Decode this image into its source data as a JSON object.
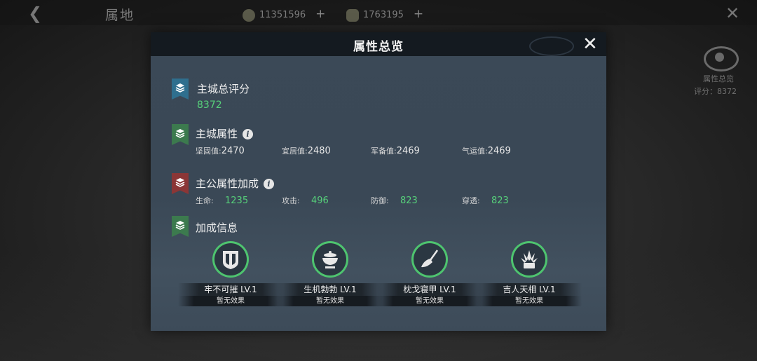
{
  "background": {
    "title": "属地",
    "resource1": "11351596",
    "resource2": "1763195",
    "plus": "+",
    "eye_label": "属性总览",
    "eye_score": "评分：8372"
  },
  "dialog": {
    "title": "属性总览",
    "close": "✕"
  },
  "overall": {
    "title": "主城总评分",
    "value": "8372"
  },
  "city_attrs": {
    "title": "主城属性",
    "items": [
      {
        "label": "坚固值:",
        "value": "2470"
      },
      {
        "label": "宜居值:",
        "value": "2480"
      },
      {
        "label": "军备值:",
        "value": "2469"
      },
      {
        "label": "气运值:",
        "value": "2469"
      }
    ]
  },
  "lord_bonus": {
    "title": "主公属性加成",
    "items": [
      {
        "label": "生命:",
        "value": "1235"
      },
      {
        "label": "攻击:",
        "value": "496"
      },
      {
        "label": "防御:",
        "value": "823"
      },
      {
        "label": "穿透:",
        "value": "823"
      }
    ]
  },
  "bonus_info": {
    "title": "加成信息",
    "buffs": [
      {
        "name": "牢不可摧 LV.1",
        "effect": "暂无效果",
        "icon": "shield-icon"
      },
      {
        "name": "生机勃勃 LV.1",
        "effect": "暂无效果",
        "icon": "bowl-icon"
      },
      {
        "name": "枕戈寝甲 LV.1",
        "effect": "暂无效果",
        "icon": "broom-icon"
      },
      {
        "name": "吉人天相 LV.1",
        "effect": "暂无效果",
        "icon": "plant-icon"
      }
    ]
  },
  "colors": {
    "accent_green": "#56d07a",
    "ring_green": "#4ec46f",
    "panel": "#3b4957",
    "header": "#141a20"
  }
}
